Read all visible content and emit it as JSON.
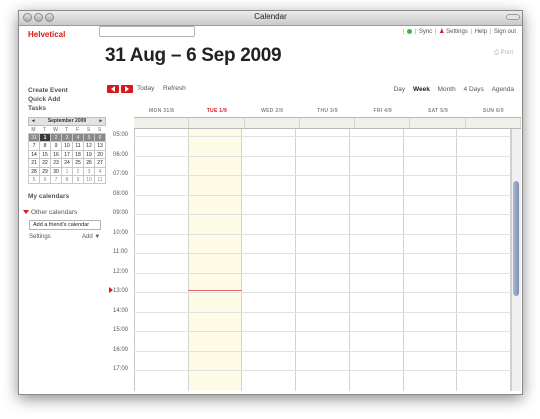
{
  "window": {
    "title": "Calendar"
  },
  "app": {
    "logo": "Helvetical"
  },
  "search": {
    "placeholder": ""
  },
  "toplinks": {
    "sync": "Sync",
    "settings": "Settings",
    "help": "Help",
    "signout": "Sign out",
    "sync_color": "#2dbd3a",
    "user_color": "#d8171d"
  },
  "header": {
    "range": "31 Aug – 6 Sep 2009",
    "print": "Print"
  },
  "leftnav": {
    "create_event": "Create Event",
    "quick_add": "Quick Add",
    "tasks": "Tasks"
  },
  "navrow": {
    "today": "Today",
    "refresh": "Refresh"
  },
  "views": {
    "day": "Day",
    "week": "Week",
    "month": "Month",
    "four_days": "4 Days",
    "agenda": "Agenda",
    "active": "Week"
  },
  "mini_calendar": {
    "title": "September 2009",
    "prev": "◂",
    "next": "▸",
    "dow": [
      "M",
      "T",
      "W",
      "T",
      "F",
      "S",
      "S"
    ],
    "weeks": [
      [
        "31",
        "1",
        "2",
        "3",
        "4",
        "5",
        "6"
      ],
      [
        "7",
        "8",
        "9",
        "10",
        "11",
        "12",
        "13"
      ],
      [
        "14",
        "15",
        "16",
        "17",
        "18",
        "19",
        "20"
      ],
      [
        "21",
        "22",
        "23",
        "24",
        "25",
        "26",
        "27"
      ],
      [
        "28",
        "29",
        "30",
        "1",
        "2",
        "3",
        "4"
      ],
      [
        "5",
        "6",
        "7",
        "8",
        "9",
        "10",
        "11"
      ]
    ]
  },
  "sidebar": {
    "my_calendars": "My calendars",
    "other_calendars": "Other calendars",
    "friend_placeholder": "Add a friend's calendar",
    "settings": "Settings",
    "add": "Add ▼"
  },
  "days": [
    {
      "label": "MON 31/8",
      "today": false
    },
    {
      "label": "TUE 1/9",
      "today": true
    },
    {
      "label": "WED 2/9",
      "today": false
    },
    {
      "label": "THU 3/9",
      "today": false
    },
    {
      "label": "FRI 4/9",
      "today": false
    },
    {
      "label": "SAT 5/9",
      "today": false
    },
    {
      "label": "SUN 6/9",
      "today": false
    }
  ],
  "times": [
    "05:00",
    "06:00",
    "07:00",
    "08:00",
    "09:00",
    "10:00",
    "11:00",
    "12:00",
    "13:00",
    "14:00",
    "15:00",
    "16:00",
    "17:00"
  ],
  "current_time": "13:00"
}
